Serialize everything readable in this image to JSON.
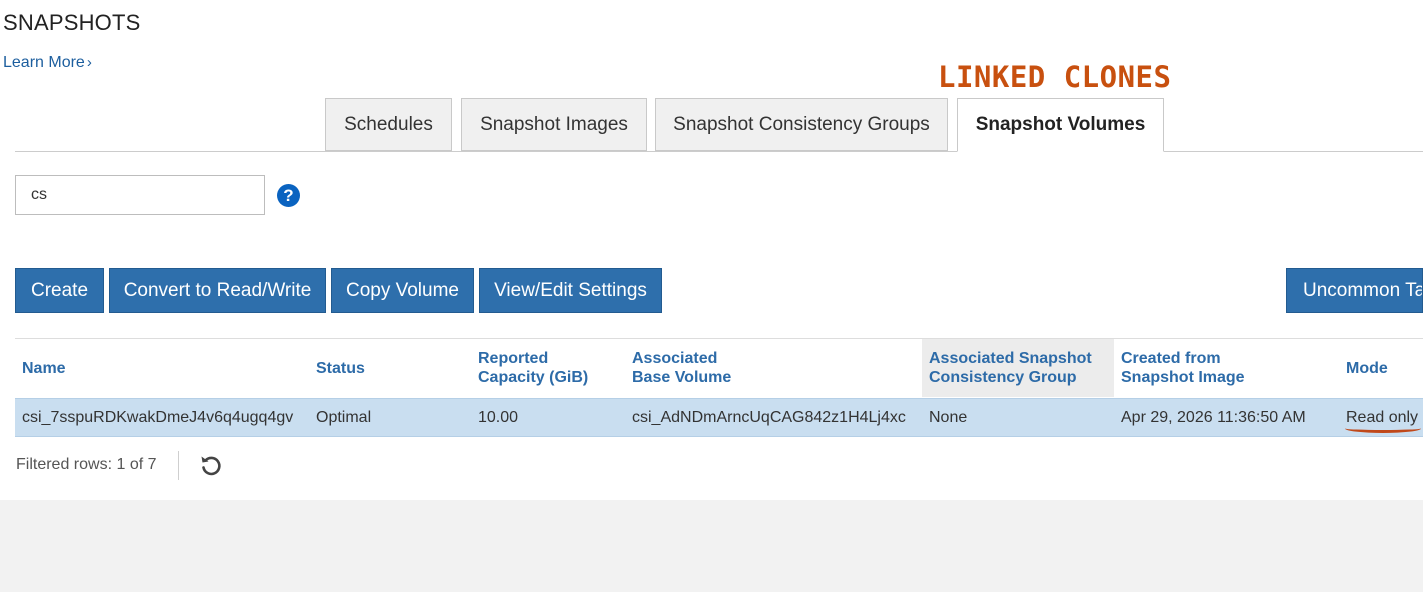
{
  "page": {
    "title": "SNAPSHOTS",
    "learn_more": "Learn More",
    "learn_more_chevron": "›",
    "annotation": "LINKED CLONES"
  },
  "tabs": [
    {
      "label": "Schedules",
      "active": false
    },
    {
      "label": "Snapshot Images",
      "active": false
    },
    {
      "label": "Snapshot Consistency Groups",
      "active": false
    },
    {
      "label": "Snapshot Volumes",
      "active": true
    }
  ],
  "search": {
    "value": "cs",
    "help_icon": "question-circle-icon",
    "help_glyph": "?"
  },
  "toolbar": {
    "create": "Create",
    "convert": "Convert to Read/Write",
    "copy": "Copy Volume",
    "view_edit": "View/Edit Settings",
    "uncommon": "Uncommon Ta"
  },
  "table": {
    "headers": [
      "Name",
      "Status",
      "Reported\nCapacity (GiB)",
      "Associated\nBase Volume",
      "Associated Snapshot\nConsistency Group",
      "Created from\nSnapshot Image",
      "Mode"
    ],
    "rows": [
      [
        "csi_7sspuRDKwakDmeJ4v6q4ugq4gv",
        "Optimal",
        "10.00",
        "csi_AdNDmArncUqCAG842z1H4Lj4xc",
        "None",
        "Apr 29, 2026 11:36:50 AM",
        "Read only"
      ]
    ]
  },
  "footer": {
    "filtered_rows": "Filtered rows: 1 of 7",
    "refresh_icon": "refresh-icon"
  },
  "colors": {
    "primary_button": "#2e6fac",
    "header_text": "#2d6ba8",
    "selected_row": "#c9def0",
    "annotation": "#c8500f"
  }
}
